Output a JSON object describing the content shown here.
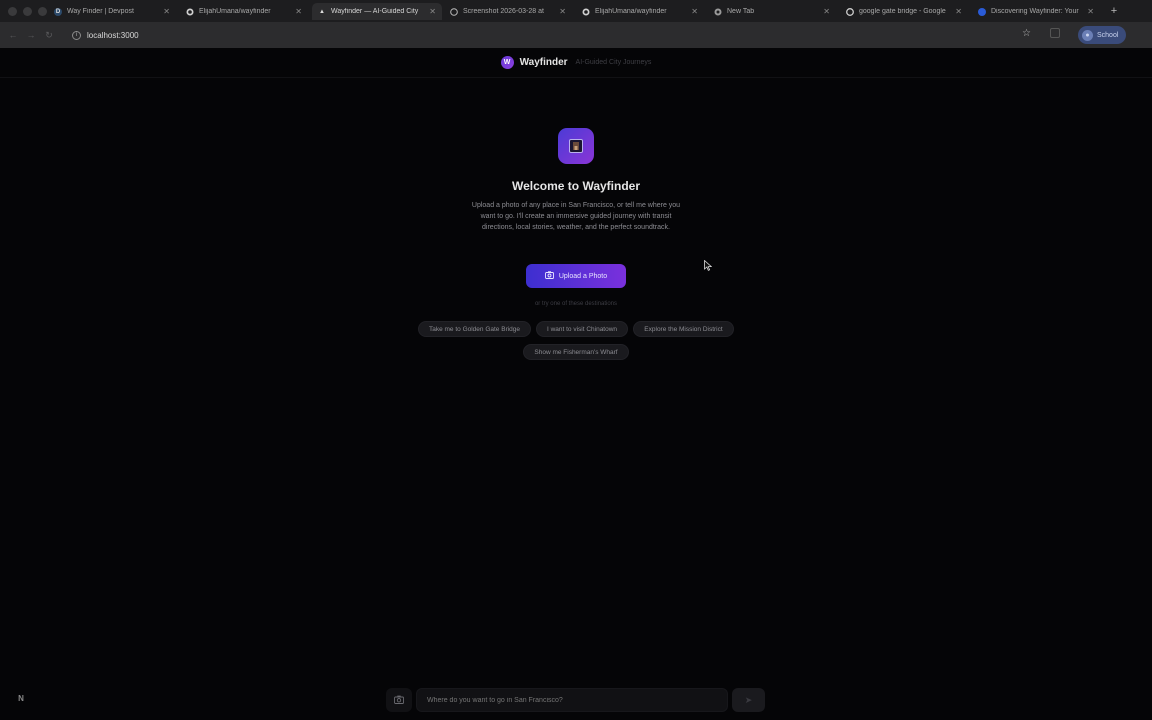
{
  "browser": {
    "tabs": [
      {
        "title": "Way Finder | Devpost",
        "favicon": "devpost-icon",
        "fav_letter": "D",
        "fav_color": "#2c4a6b",
        "active": false
      },
      {
        "title": "ElijahUmana/wayfinder",
        "favicon": "github-icon",
        "fav_letter": "",
        "fav_color": "#1d1d1f",
        "active": false
      },
      {
        "title": "Wayfinder — AI-Guided City",
        "favicon": "wayfinder-icon",
        "fav_letter": "▲",
        "fav_color": "#2c2c2e",
        "active": true
      },
      {
        "title": "Screenshot 2026-03-28 at",
        "favicon": "screenshot-icon",
        "fav_letter": "",
        "fav_color": "#1d1d1f",
        "active": false
      },
      {
        "title": "ElijahUmana/wayfinder",
        "favicon": "github-icon",
        "fav_letter": "",
        "fav_color": "#1d1d1f",
        "active": false
      },
      {
        "title": "New Tab",
        "favicon": "chrome-icon",
        "fav_letter": "",
        "fav_color": "#1d1d1f",
        "active": false
      },
      {
        "title": "google gate bridge - Google",
        "favicon": "google-icon",
        "fav_letter": "",
        "fav_color": "#1d1d1f",
        "active": false
      },
      {
        "title": "Discovering Wayfinder: Your",
        "favicon": "docs-icon",
        "fav_letter": "",
        "fav_color": "#2a5bd7",
        "active": false
      }
    ],
    "url": "localhost:3000",
    "profile_label": "School",
    "new_tab_label": "+"
  },
  "header": {
    "logo_letter": "W",
    "brand": "Wayfinder",
    "tagline": "AI-Guided City Journeys"
  },
  "hero": {
    "title": "Welcome to Wayfinder",
    "description": "Upload a photo of any place in San Francisco, or tell me where you want to go. I'll create an immersive guided journey with transit directions, local stories, weather, and the perfect soundtrack.",
    "upload_label": "Upload a Photo",
    "or_text": "or try one of these destinations"
  },
  "suggestions": [
    "Take me to Golden Gate Bridge",
    "I want to visit Chinatown",
    "Explore the Mission District",
    "Show me Fisherman's Wharf"
  ],
  "composer": {
    "placeholder": "Where do you want to go in San Francisco?",
    "send_label": "➤"
  },
  "corner_badge": "N",
  "colors": {
    "accent_start": "#3d2fd0",
    "accent_end": "#7a30dc",
    "background": "#050507"
  }
}
